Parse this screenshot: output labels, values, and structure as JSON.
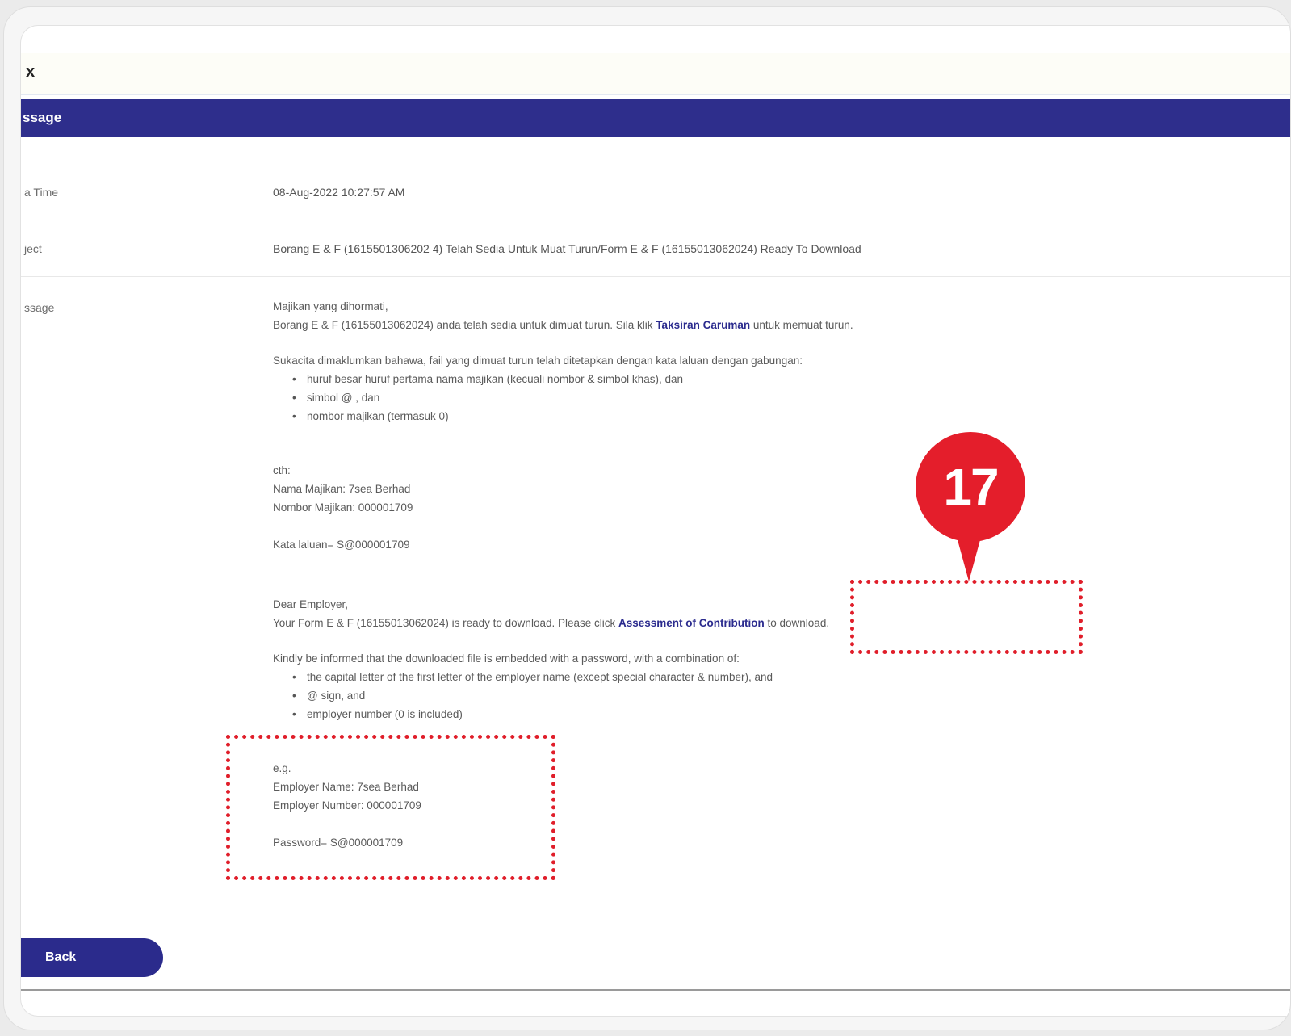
{
  "window": {
    "title": "x"
  },
  "header": {
    "title": "ssage"
  },
  "rows": {
    "datetime": {
      "label": "a Time",
      "value": "08-Aug-2022 10:27:57 AM"
    },
    "subject": {
      "label": "ject",
      "value": "Borang E & F (1615501306202 4) Telah Sedia Untuk Muat Turun/Form E & F (16155013062024) Ready To Download"
    },
    "message": {
      "label": "ssage"
    }
  },
  "message_ms": {
    "greeting": "Majikan yang dihormati,",
    "line1_before": "Borang E & F (16155013062024) anda telah sedia untuk dimuat turun. Sila klik ",
    "line1_link": "Taksiran Caruman",
    "line1_after": " untuk memuat turun.",
    "intro": "Sukacita dimaklumkan bahawa, fail yang dimuat turun telah ditetapkan dengan kata laluan dengan gabungan:",
    "bullets": [
      "huruf besar huruf pertama nama majikan (kecuali nombor & simbol khas), dan",
      "simbol @ , dan",
      "nombor majikan (termasuk 0)"
    ],
    "eg_label": "cth:",
    "eg_name": "Nama Majikan: 7sea Berhad",
    "eg_number": "Nombor Majikan: 000001709",
    "eg_password": "Kata laluan= S@000001709"
  },
  "message_en": {
    "greeting": "Dear Employer,",
    "line1_before": "Your Form E & F (16155013062024) is ready to download. Please click ",
    "line1_link": "Assessment of Contribution",
    "line1_after": " to download.",
    "intro": "Kindly be informed that the downloaded file is embedded with a password, with a combination of:",
    "bullets": [
      "the capital letter of the first letter of the employer name (except special character & number), and",
      "@ sign, and",
      "employer number (0 is included)"
    ],
    "eg_label": "e.g.",
    "eg_name": "Employer Name: 7sea Berhad",
    "eg_number": "Employer Number: 000001709",
    "eg_password": "Password= S@000001709"
  },
  "back_button": {
    "label": "Back"
  },
  "annotation": {
    "step_number": "17",
    "color": "#e41e2b"
  }
}
